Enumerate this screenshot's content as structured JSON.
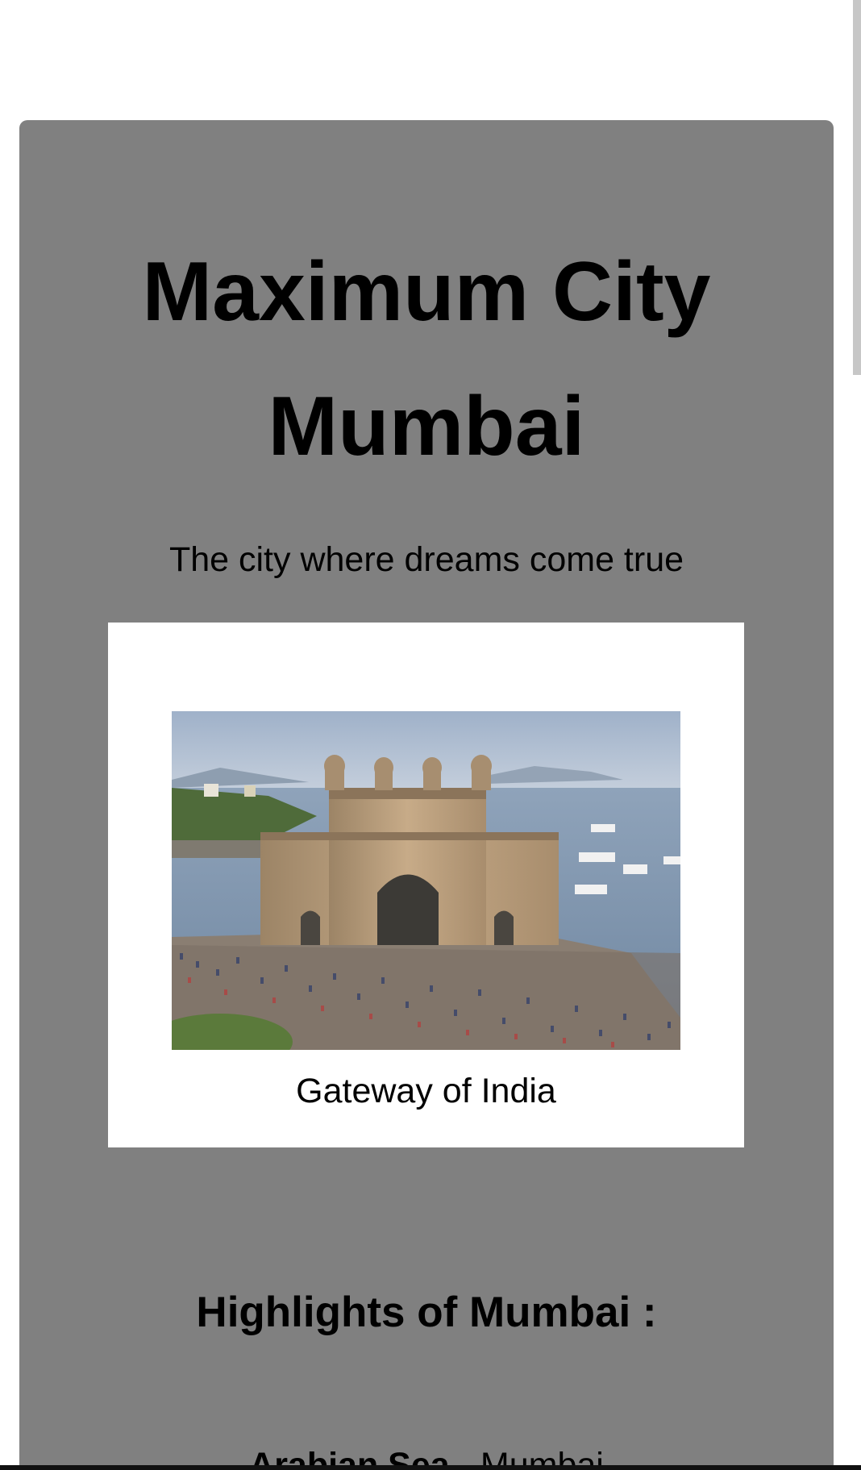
{
  "hero": {
    "title_line1": "Maximum City",
    "title_line2": "Mumbai",
    "tagline": "The city where dreams come true"
  },
  "figure": {
    "image_subject": "Gateway of India monument by the sea with crowds",
    "caption": "Gateway of India"
  },
  "highlights": {
    "heading": "Highlights of Mumbai :",
    "items": [
      {
        "name": "Arabian Sea",
        "separator": " - ",
        "description": "Mumbai"
      }
    ]
  },
  "colors": {
    "card_background": "#808080",
    "figure_background": "#ffffff",
    "text": "#000000",
    "scrollbar_thumb": "#c7c7c7"
  }
}
